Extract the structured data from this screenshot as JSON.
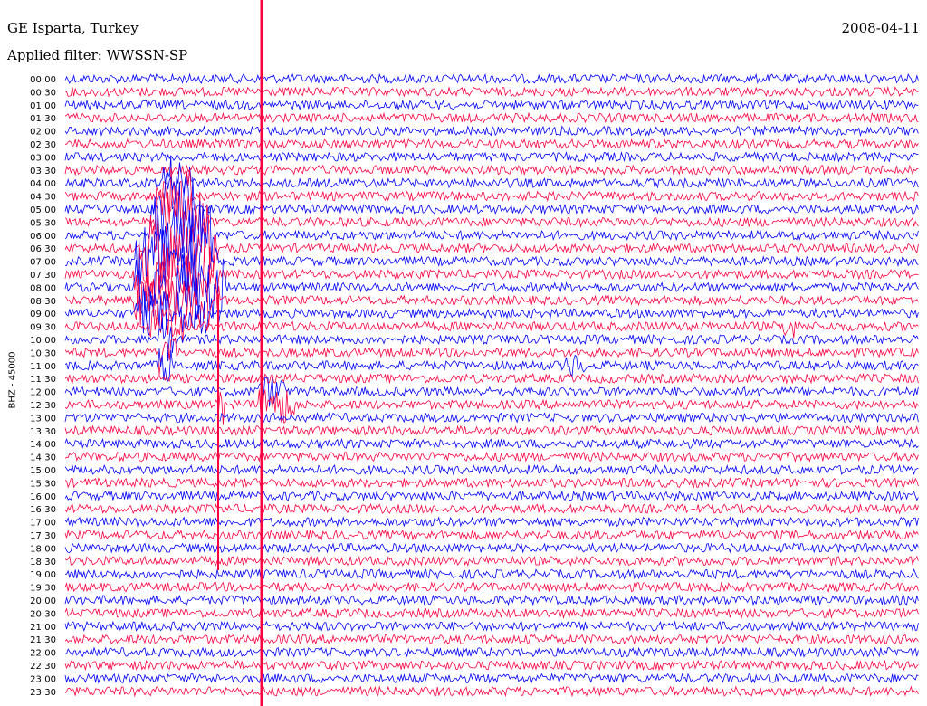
{
  "header": {
    "station": "GE Isparta, Turkey",
    "date": "2008-04-11",
    "filter": "Applied filter: WWSSN-SP",
    "channel": "BHZ  -  45000"
  },
  "colors": {
    "trace_a": "#0000ff",
    "trace_b": "#ff0040",
    "event_line": "#ff0040"
  },
  "chart_data": {
    "type": "line",
    "subtype": "helicorder",
    "title": "GE Isparta, Turkey",
    "ylabel": "BHZ  -  45000",
    "row_labels": [
      "00:00",
      "00:30",
      "01:00",
      "01:30",
      "02:00",
      "02:30",
      "03:00",
      "03:30",
      "04:00",
      "04:30",
      "05:00",
      "05:30",
      "06:00",
      "06:30",
      "07:00",
      "07:30",
      "08:00",
      "08:30",
      "09:00",
      "09:30",
      "10:00",
      "10:30",
      "11:00",
      "11:30",
      "12:00",
      "12:30",
      "13:00",
      "13:30",
      "14:00",
      "14:30",
      "15:00",
      "15:30",
      "16:00",
      "16:30",
      "17:00",
      "17:30",
      "18:00",
      "18:30",
      "19:00",
      "19:30",
      "20:00",
      "20:30",
      "21:00",
      "21:30",
      "22:00",
      "22:30",
      "23:00",
      "23:30"
    ],
    "row_minutes": 30,
    "grid": false
  }
}
